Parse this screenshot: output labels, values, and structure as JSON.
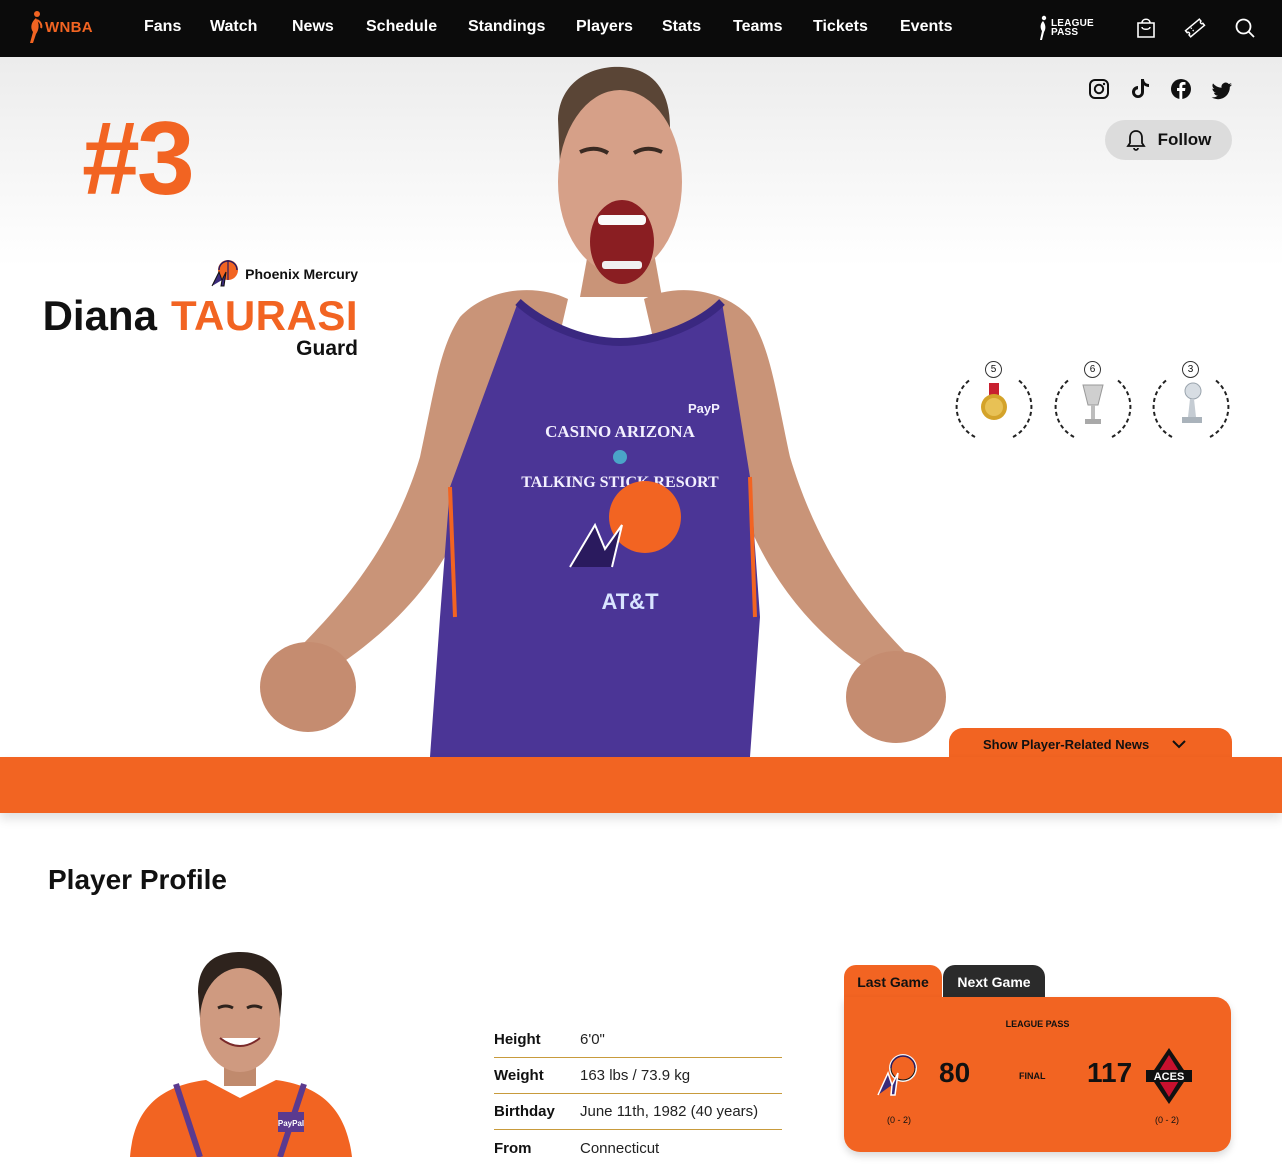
{
  "nav": {
    "logo_text": "WNBA",
    "items": [
      "Fans",
      "Watch",
      "News",
      "Schedule",
      "Standings",
      "Players",
      "Stats",
      "Teams",
      "Tickets",
      "Events"
    ],
    "league_pass_line1": "LEAGUE",
    "league_pass_line2": "PASS",
    "icons": [
      "shopping-bag-icon",
      "ticket-icon",
      "search-icon"
    ]
  },
  "hero": {
    "jersey_number": "#3",
    "team_name": "Phoenix Mercury",
    "first_name": "Diana",
    "last_name": "TAURASI",
    "position": "Guard",
    "social_icons": [
      "instagram-icon",
      "tiktok-icon",
      "facebook-icon",
      "twitter-icon"
    ],
    "follow_label": "Follow",
    "awards": [
      {
        "icon": "olympic-medal-icon",
        "count": "5"
      },
      {
        "icon": "championship-trophy-icon",
        "count": "6"
      },
      {
        "icon": "mvp-trophy-icon",
        "count": "3"
      }
    ],
    "news_toggle_label": "Show Player-Related News"
  },
  "profile": {
    "title": "Player Profile",
    "stats": [
      {
        "label": "Height",
        "value": "6'0\""
      },
      {
        "label": "Weight",
        "value": "163 lbs / 73.9 kg"
      },
      {
        "label": "Birthday",
        "value": "June 11th, 1982 (40 years)"
      },
      {
        "label": "From",
        "value": "Connecticut"
      }
    ]
  },
  "game": {
    "tabs": [
      "Last Game",
      "Next Game"
    ],
    "active_tab": "Last Game",
    "network": "LEAGUE PASS",
    "home_score": "80",
    "status": "FINAL",
    "away_score": "117",
    "home_record": "(0 - 2)",
    "away_record": "(0 - 2)",
    "away_logo_text": "ACES"
  },
  "colors": {
    "accent": "#f26422",
    "nav_bg": "#0b0b0b",
    "jersey_purple": "#4b3596"
  }
}
